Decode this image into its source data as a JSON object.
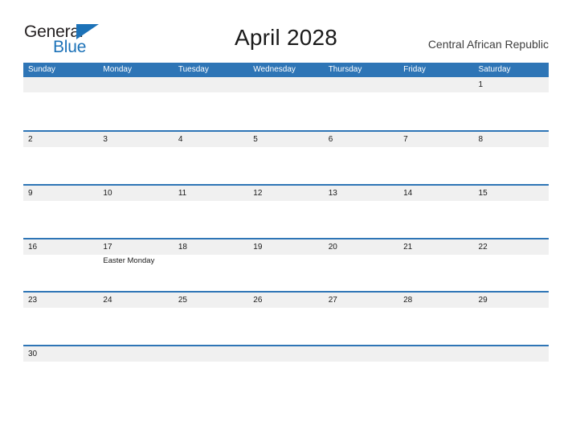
{
  "branding": {
    "logo_primary": "General",
    "logo_secondary": "Blue",
    "logo_flag_icon": "blue-flag-triangle-icon",
    "primary_color": "#231f20",
    "secondary_color": "#1c72b8"
  },
  "header": {
    "title": "April 2028",
    "country": "Central African Republic"
  },
  "theme": {
    "header_blue": "#2e75b6",
    "band_gray": "#f0f0f0",
    "page_background": "#ffffff",
    "text_color": "#1a1a1a"
  },
  "calendar": {
    "month": "April",
    "year": "2028",
    "weekdays": [
      "Sunday",
      "Monday",
      "Tuesday",
      "Wednesday",
      "Thursday",
      "Friday",
      "Saturday"
    ],
    "weeks": [
      [
        {
          "date": "",
          "event": ""
        },
        {
          "date": "",
          "event": ""
        },
        {
          "date": "",
          "event": ""
        },
        {
          "date": "",
          "event": ""
        },
        {
          "date": "",
          "event": ""
        },
        {
          "date": "",
          "event": ""
        },
        {
          "date": "1",
          "event": ""
        }
      ],
      [
        {
          "date": "2",
          "event": ""
        },
        {
          "date": "3",
          "event": ""
        },
        {
          "date": "4",
          "event": ""
        },
        {
          "date": "5",
          "event": ""
        },
        {
          "date": "6",
          "event": ""
        },
        {
          "date": "7",
          "event": ""
        },
        {
          "date": "8",
          "event": ""
        }
      ],
      [
        {
          "date": "9",
          "event": ""
        },
        {
          "date": "10",
          "event": ""
        },
        {
          "date": "11",
          "event": ""
        },
        {
          "date": "12",
          "event": ""
        },
        {
          "date": "13",
          "event": ""
        },
        {
          "date": "14",
          "event": ""
        },
        {
          "date": "15",
          "event": ""
        }
      ],
      [
        {
          "date": "16",
          "event": ""
        },
        {
          "date": "17",
          "event": "Easter Monday"
        },
        {
          "date": "18",
          "event": ""
        },
        {
          "date": "19",
          "event": ""
        },
        {
          "date": "20",
          "event": ""
        },
        {
          "date": "21",
          "event": ""
        },
        {
          "date": "22",
          "event": ""
        }
      ],
      [
        {
          "date": "23",
          "event": ""
        },
        {
          "date": "24",
          "event": ""
        },
        {
          "date": "25",
          "event": ""
        },
        {
          "date": "26",
          "event": ""
        },
        {
          "date": "27",
          "event": ""
        },
        {
          "date": "28",
          "event": ""
        },
        {
          "date": "29",
          "event": ""
        }
      ],
      [
        {
          "date": "30",
          "event": ""
        },
        {
          "date": "",
          "event": ""
        },
        {
          "date": "",
          "event": ""
        },
        {
          "date": "",
          "event": ""
        },
        {
          "date": "",
          "event": ""
        },
        {
          "date": "",
          "event": ""
        },
        {
          "date": "",
          "event": ""
        }
      ]
    ]
  }
}
